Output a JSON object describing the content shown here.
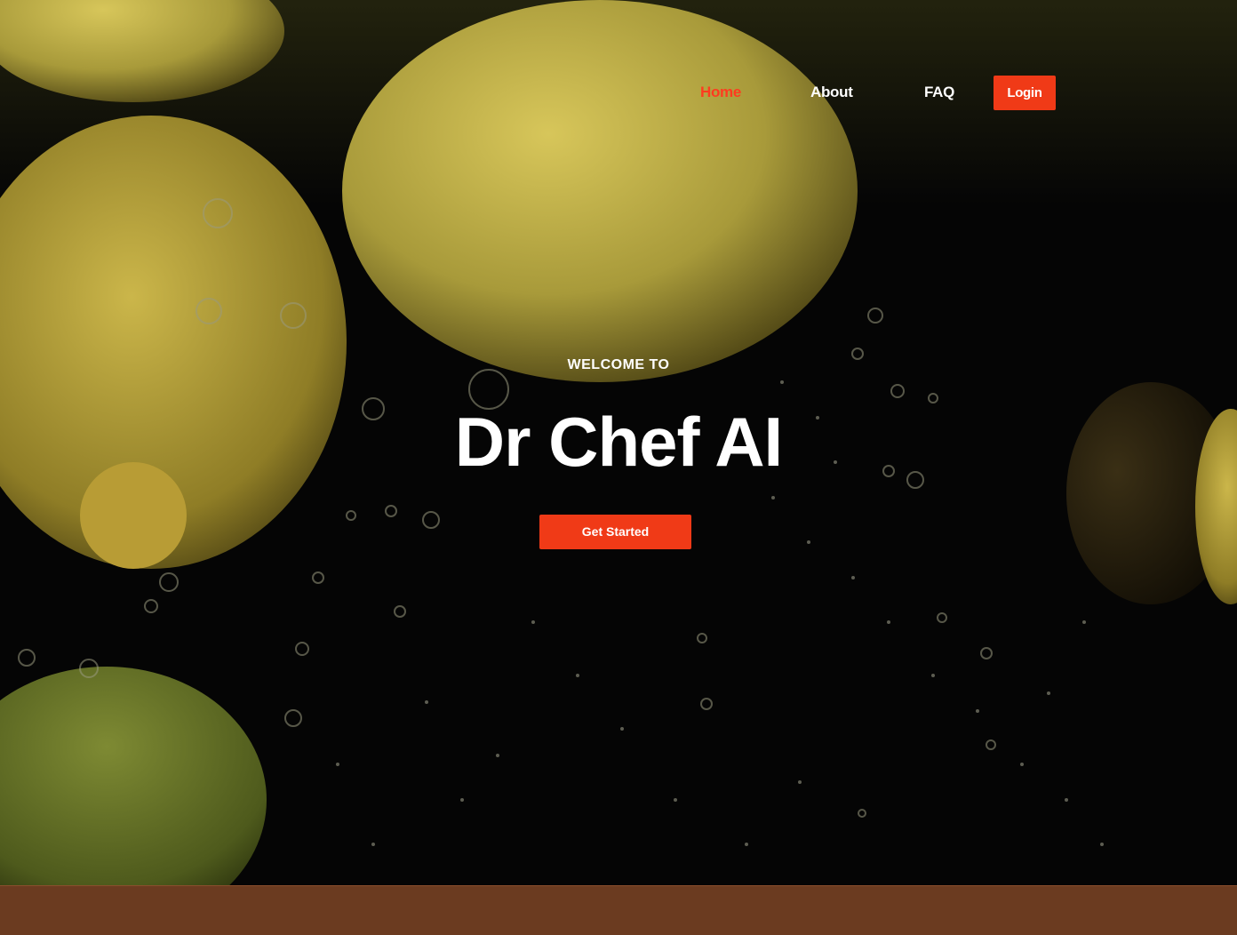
{
  "nav": {
    "home_label": "Home",
    "about_label": "About",
    "faq_label": "FAQ",
    "login_label": "Login"
  },
  "hero": {
    "welcome_text": "WELCOME TO",
    "title": "Dr Chef AI",
    "cta_label": "Get Started"
  },
  "colors": {
    "accent": "#f03a17",
    "footer_band": "#6b3b20",
    "background": "#050505"
  }
}
